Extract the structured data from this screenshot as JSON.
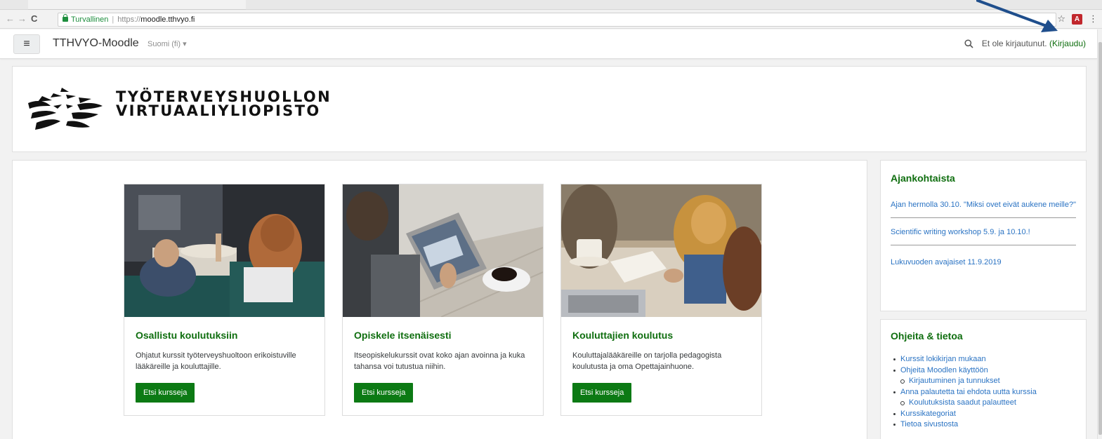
{
  "browser": {
    "security_label": "Turvallinen",
    "url_scheme": "https://",
    "url_host": "moodle.tthvyo.fi",
    "star_icon": "☆",
    "menu_icon": "⋮",
    "pdf_icon_label": "A",
    "back_icon": "←",
    "forward_icon": "→",
    "reload_icon": "C"
  },
  "navbar": {
    "menu_icon": "≡",
    "brand": "TTHVYO-Moodle",
    "language": "Suomi (fi) ▾",
    "login_status": "Et ole kirjautunut.",
    "login_link": "(Kirjaudu)"
  },
  "header": {
    "logo_line1": "TYÖTERVEYSHUOLLON",
    "logo_line2": "VIRTUAALIYLIOPISTO"
  },
  "courses": [
    {
      "title": "Osallistu koulutuksiin",
      "description": "Ohjatut kurssit työterveyshuoltoon erikoistuville lääkäreille ja kouluttajille.",
      "button": "Etsi kursseja"
    },
    {
      "title": "Opiskele itsenäisesti",
      "description": "Itseopiskelukurssit ovat koko ajan avoinna ja kuka tahansa voi tutustua niihin.",
      "button": "Etsi kursseja"
    },
    {
      "title": "Kouluttajien koulutus",
      "description": "Kouluttajalääkäreille on tarjolla pedagogista koulutusta ja oma Opettajainhuone.",
      "button": "Etsi kursseja"
    }
  ],
  "news": {
    "title": "Ajankohtaista",
    "items": [
      "Ajan hermolla 30.10. \"Miksi ovet eivät aukene meille?\"",
      "Scientific writing workshop 5.9. ja 10.10.!",
      "Lukuvuoden avajaiset 11.9.2019"
    ]
  },
  "help": {
    "title": "Ohjeita & tietoa",
    "items": [
      "Kurssit lokikirjan mukaan",
      "Ohjeita Moodlen käyttöön",
      "Kirjautuminen ja tunnukset",
      "Anna palautetta tai ehdota uutta kurssia",
      "Koulutuksista saadut palautteet",
      "Kurssikategoriat",
      "Tietoa sivustosta"
    ]
  },
  "colors": {
    "accent_green": "#0f6e0f",
    "button_green": "#0c7a14",
    "link_blue": "#2a73c3",
    "annotation_arrow": "#1f4e8c"
  }
}
